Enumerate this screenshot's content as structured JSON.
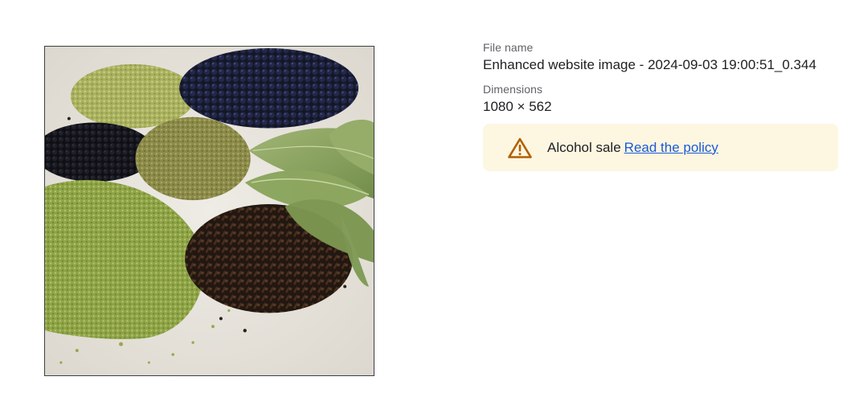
{
  "image": {
    "subject-icon": "spices-photo-icon"
  },
  "details": {
    "file_name_label": "File name",
    "file_name_value": "Enhanced website image - 2024-09-03 19:00:51_0.344",
    "dimensions_label": "Dimensions",
    "dimensions_value": "1080 × 562"
  },
  "notice": {
    "icon": "warning-icon",
    "text": "Alcohol sale",
    "link_label": "Read the policy",
    "background": "#fdf6e1",
    "icon_color": "#b06000",
    "link_color": "#1a5bd6"
  }
}
